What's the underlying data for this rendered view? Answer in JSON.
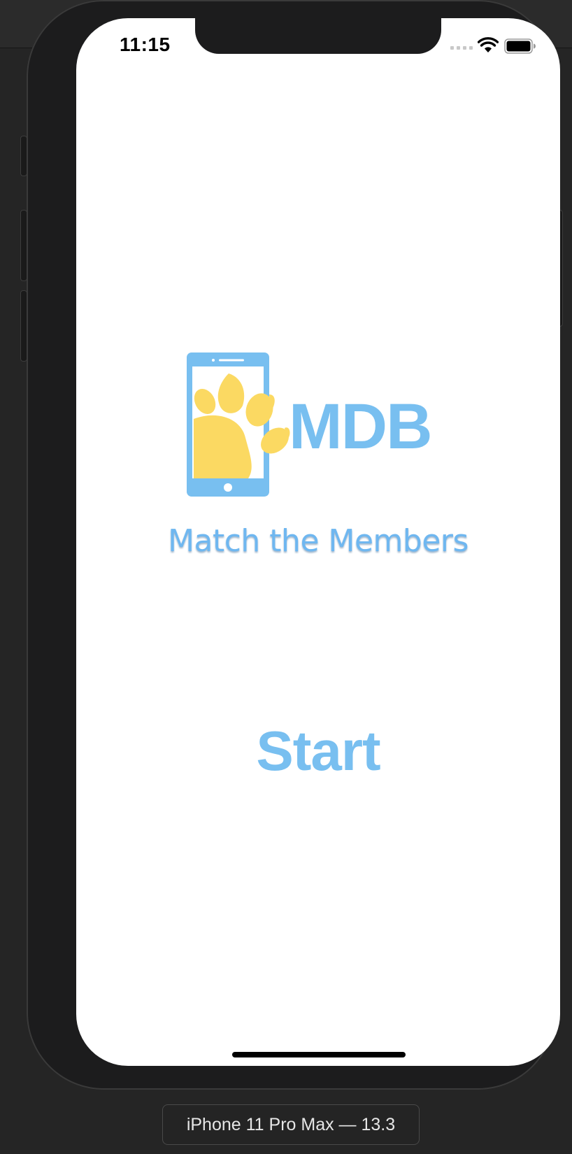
{
  "status_bar": {
    "time": "11:15"
  },
  "app": {
    "logo_text": "MDB",
    "tagline": "Match the Members",
    "start_label": "Start"
  },
  "simulator": {
    "device_label": "iPhone 11 Pro Max — 13.3"
  },
  "colors": {
    "accent_blue": "#78bff0",
    "paw_yellow": "#fbd962",
    "screen_background": "#ffffff"
  }
}
